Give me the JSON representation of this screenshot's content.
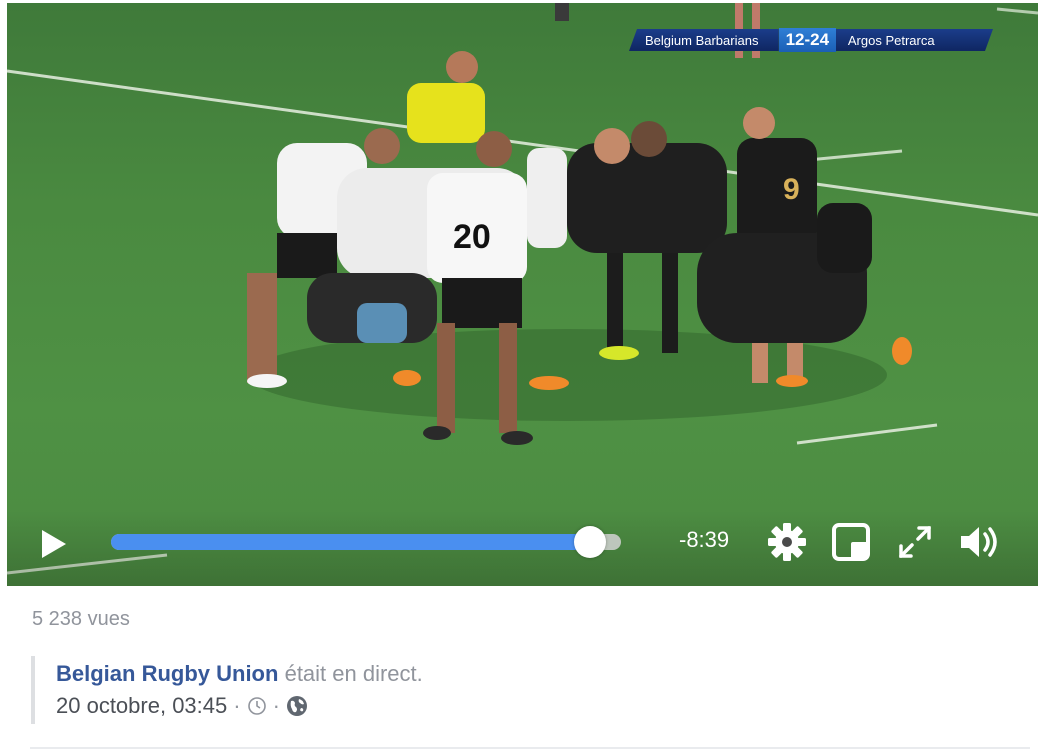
{
  "scoreboard": {
    "home_team": "Belgium Barbarians",
    "score": "12-24",
    "away_team": "Argos Petrarca"
  },
  "player": {
    "play_icon": "play-icon",
    "progress": 0.94,
    "time_remaining": "-8:39",
    "settings_icon": "gear-icon",
    "miniplayer_icon": "picture-in-picture-icon",
    "fullscreen_icon": "fullscreen-icon",
    "volume_icon": "volume-icon"
  },
  "post": {
    "views": "5 238 vues",
    "page_name": "Belgian Rugby Union",
    "live_text": "était en direct.",
    "date": "20 octobre, 03:45",
    "separator": "·",
    "clock_icon": "clock-icon",
    "privacy_icon": "globe-icon"
  },
  "colors": {
    "accent": "#4a8ff0",
    "link": "#365899",
    "muted": "#90949c"
  }
}
